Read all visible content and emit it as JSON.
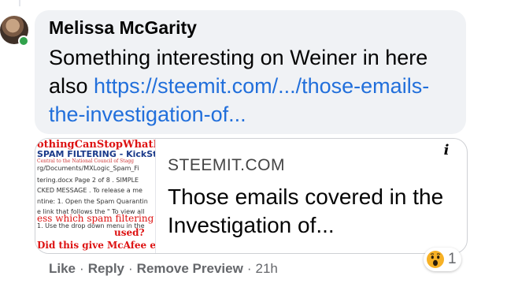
{
  "comment": {
    "author": "Melissa McGarity",
    "text": "Something interesting on Weiner in here also ",
    "link_text": "https://steemit.com/.../those-emails-the-investigation-of..."
  },
  "preview": {
    "thumbnail_text": [
      "othingCanStopWhatIsC",
      "SPAM FILTERING - KickSt",
      "Central to the National Council of Stagg",
      "rg/Documents/MXLogic_Spam_Fi",
      "tering.docx Page 2 of 8 . SIMPLE",
      "CKED MESSAGE . To release a me",
      "ntine: 1. Open the Spam Quarantin",
      "e link that follows the \" To view all",
      "ess which spam filtering",
      "1. Use the drop down menu in the",
      "used?",
      "Did this give McAfee em"
    ],
    "domain": "STEEMIT.COM",
    "title": "Those emails covered in the Investigation of..."
  },
  "info_button": "i",
  "actions": {
    "like": "Like",
    "reply": "Reply",
    "remove_preview": "Remove Preview",
    "separator": "·",
    "time": "21h"
  },
  "reactions": {
    "icon": "wow-reaction-icon",
    "count": "1"
  }
}
